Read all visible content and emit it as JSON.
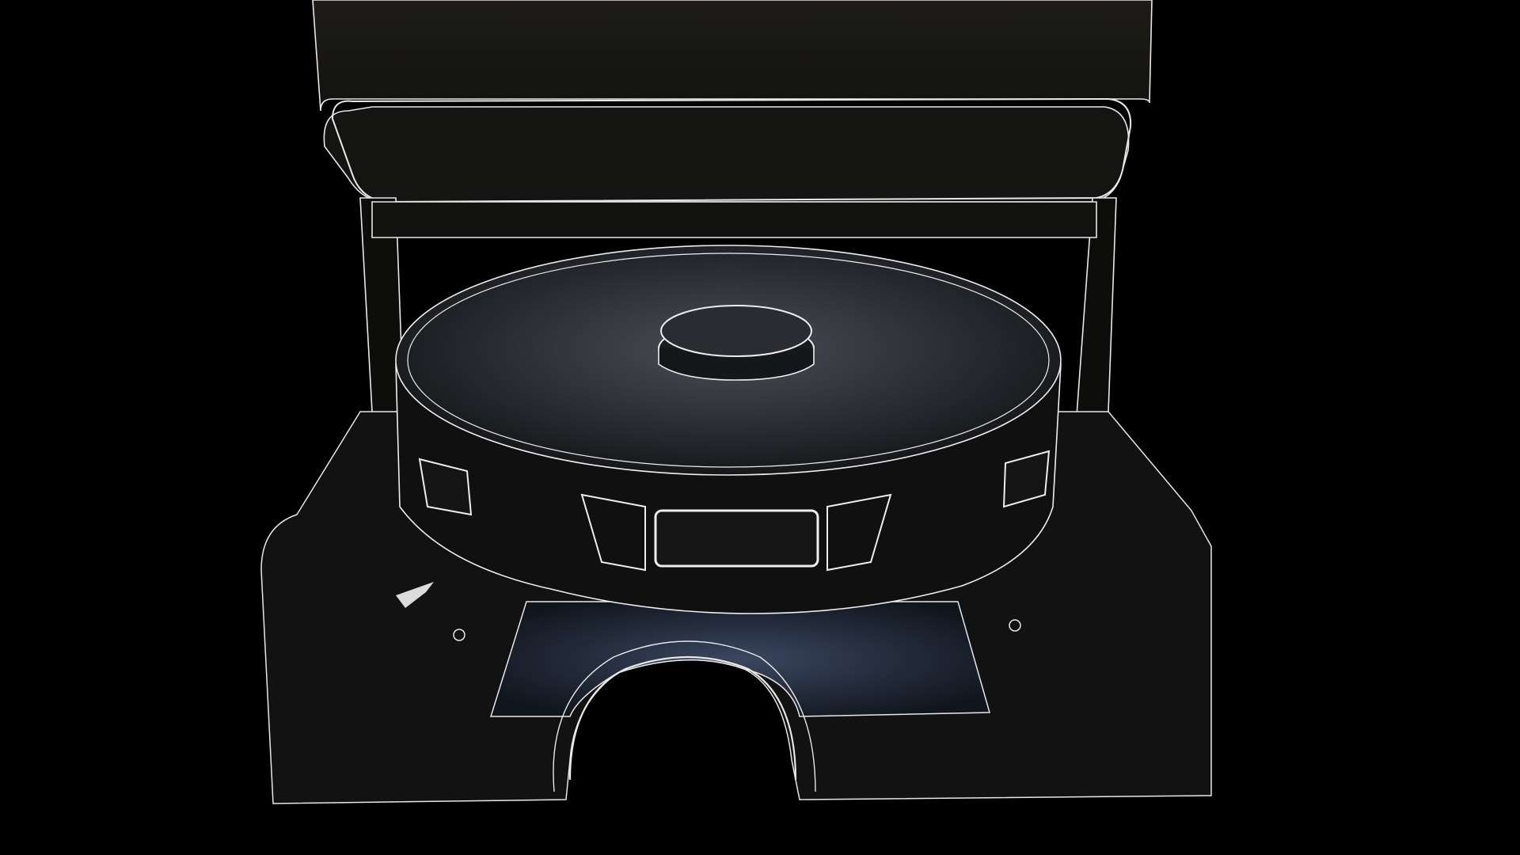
{
  "scene": {
    "subject": "robot-vacuum-on-docking-station",
    "render_style": "wireframe",
    "colors": {
      "background": "#000000",
      "wire": "#ffffff",
      "surface_dark": "#0b0b0a",
      "surface_mid": "#1c1c1a",
      "floor_glow": "#2e3a4c"
    }
  }
}
